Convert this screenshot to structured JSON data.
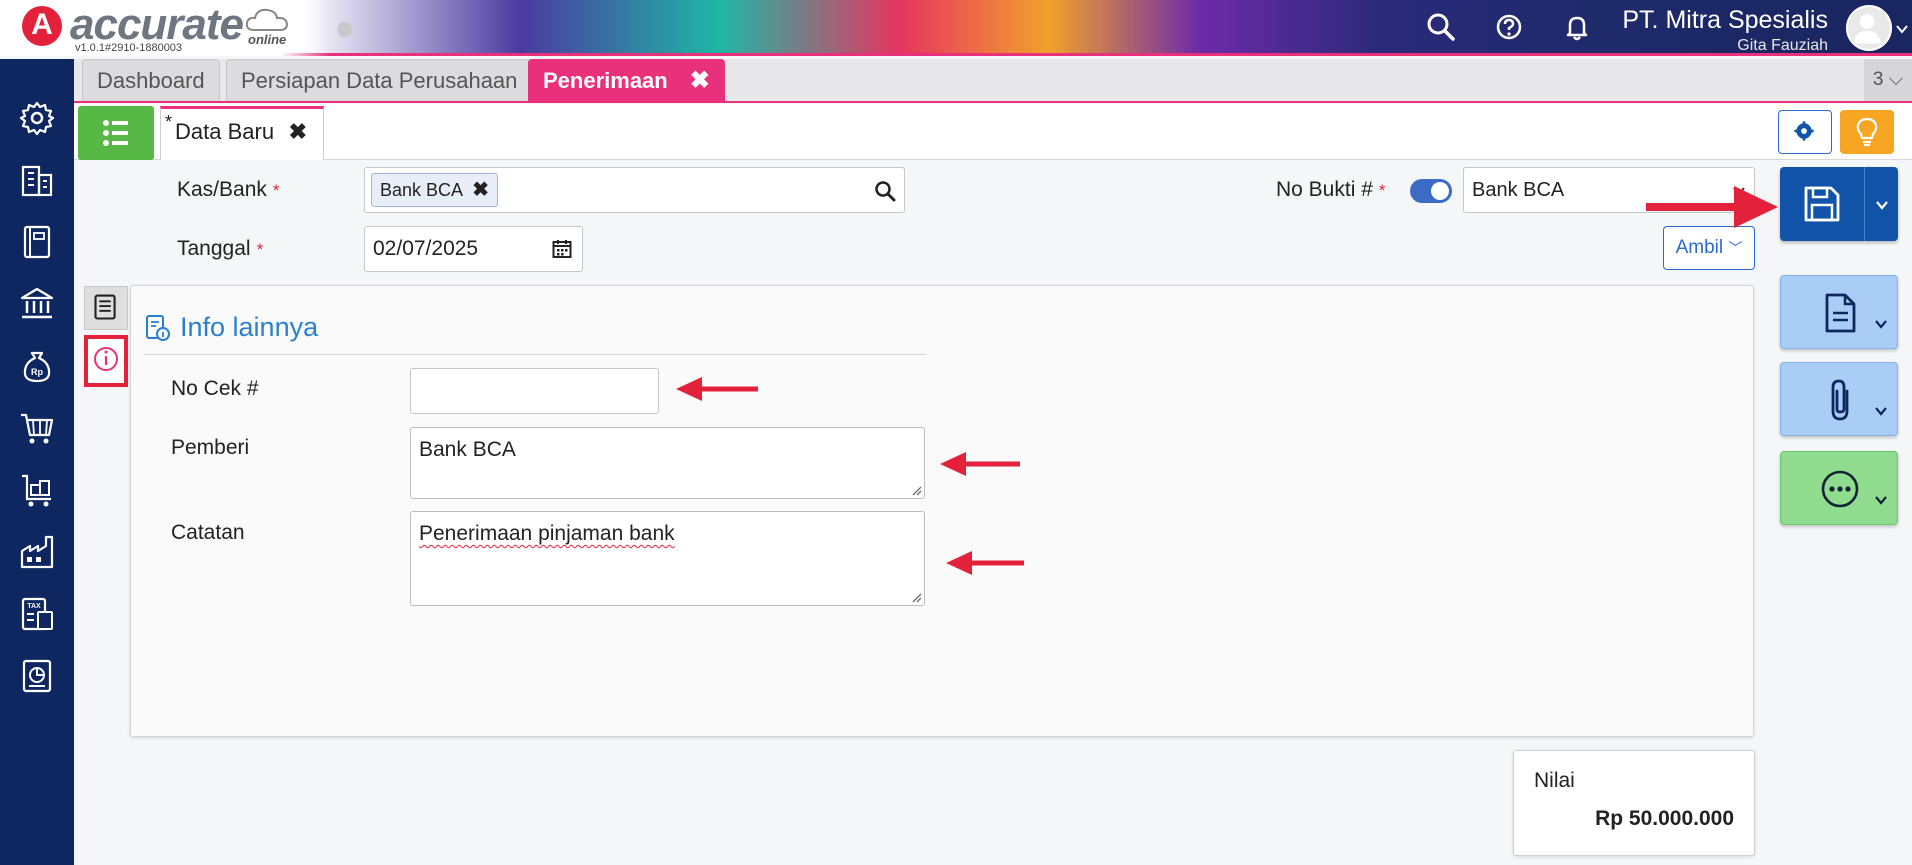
{
  "header": {
    "logo_letter": "A",
    "logo_text": "accurate",
    "logo_sub": "online",
    "version": "v1.0.1#2910-1880003",
    "company_name": "PT. Mitra Spesialis",
    "user_name": "Gita Fauziah"
  },
  "tabs": [
    {
      "label": "Dashboard"
    },
    {
      "label": "Persiapan Data Perusahaan"
    },
    {
      "label": "Penerimaan",
      "close": "✖"
    }
  ],
  "tab_count": "3 ⌵",
  "form_tab": {
    "modified_mark": "*",
    "label": "Data Baru",
    "close": "✖"
  },
  "form": {
    "kas_bank_label": "Kas/Bank",
    "required_mark": "*",
    "kas_bank_chip": "Bank BCA",
    "chip_close": "✖",
    "tanggal_label": "Tanggal",
    "tanggal_value": "02/07/2025",
    "no_bukti_label": "No Bukti #",
    "no_bukti_value": "Bank BCA",
    "ambil_label": "Ambil"
  },
  "panel": {
    "title": "Info lainnya",
    "no_cek_label": "No Cek #",
    "no_cek_value": "",
    "pemberi_label": "Pemberi",
    "pemberi_value": "Bank BCA",
    "catatan_label": "Catatan",
    "catatan_value": "Penerimaan pinjaman bank"
  },
  "nilai": {
    "label": "Nilai",
    "value": "Rp 50.000.000"
  },
  "colors": {
    "accent_pink": "#e8317a",
    "sidebar_navy": "#0f2761",
    "save_blue": "#1053a8",
    "list_green": "#57b845",
    "annotation_red": "#e3213a"
  }
}
